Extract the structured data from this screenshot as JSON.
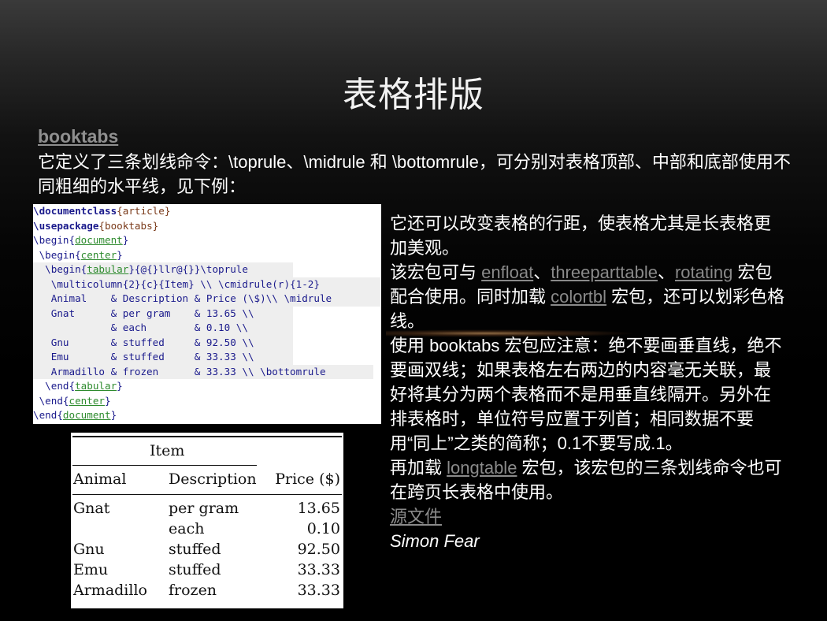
{
  "slide": {
    "title": "表格排版",
    "package_link": "booktabs",
    "intro": "它定义了三条划线命令：\\toprule、\\midrule 和 \\bottomrule，可分别对表格顶部、中部和底部使用不同粗细的水平线，见下例："
  },
  "code_lines": [
    {
      "a": "\\documentclass",
      "b": "{article}"
    },
    {
      "a": "\\usepackage",
      "b": "{booktabs}"
    },
    {
      "a": "\\begin{",
      "g": "document",
      "c": "}"
    },
    {
      "a": " \\begin{",
      "g": "center",
      "c": "}"
    },
    {
      "a": "  \\begin{",
      "g": "tabular",
      "c": "}{@{}llr@{}}\\toprule"
    },
    {
      "a": "   \\multicolumn{2}{c}{Item} \\\\ \\cmidrule(r){1-2}"
    },
    {
      "a": "   Animal    & Description & Price (\\$)\\\\ \\midrule"
    },
    {
      "a": "   Gnat      & per gram    & 13.65 \\\\"
    },
    {
      "a": "             & each        & 0.10 \\\\"
    },
    {
      "a": "   Gnu       & stuffed     & 92.50 \\\\"
    },
    {
      "a": "   Emu       & stuffed     & 33.33 \\\\"
    },
    {
      "a": "   Armadillo & frozen      & 33.33 \\\\ \\bottomrule"
    },
    {
      "a": "  \\end{",
      "g": "tabular",
      "c": "}"
    },
    {
      "a": " \\end{",
      "g": "center",
      "c": "}"
    },
    {
      "a": "\\end{",
      "g": "document",
      "c": "}"
    }
  ],
  "rendered_table": {
    "group_header": "Item",
    "headers": [
      "Animal",
      "Description",
      "Price ($)"
    ],
    "rows": [
      [
        "Gnat",
        "per gram",
        "13.65"
      ],
      [
        "",
        "each",
        "0.10"
      ],
      [
        "Gnu",
        "stuffed",
        "92.50"
      ],
      [
        "Emu",
        "stuffed",
        "33.33"
      ],
      [
        "Armadillo",
        "frozen",
        "33.33"
      ]
    ]
  },
  "right": {
    "p1": "它还可以改变表格的行距，使表格尤其是长表格更加美观。",
    "p2_pre": "该宏包可与 ",
    "link_enfloat": "enfloat",
    "sep1": "、",
    "link_threeparttable": "threeparttable",
    "sep2": "、",
    "link_rotating": "rotating",
    "p2_mid": " 宏包配合使用。同时加载 ",
    "link_colortbl": "colortbl",
    "p2_post": " 宏包，还可以划彩色格线。",
    "p3": "使用 booktabs 宏包应注意：绝不要画垂直线，绝不要画双线；如果表格左右两边的内容毫无关联，最好将其分为两个表格而不是用垂直线隔开。另外在排表格时，单位符号应置于列首；相同数据不要用“同上”之类的简称；0.1不要写成.1。",
    "p4_pre": "再加载 ",
    "link_longtable": "longtable",
    "p4_post": " 宏包，该宏包的三条划线命令也可在跨页长表格中使用。",
    "source_link": "源文件",
    "author": "Simon Fear"
  }
}
